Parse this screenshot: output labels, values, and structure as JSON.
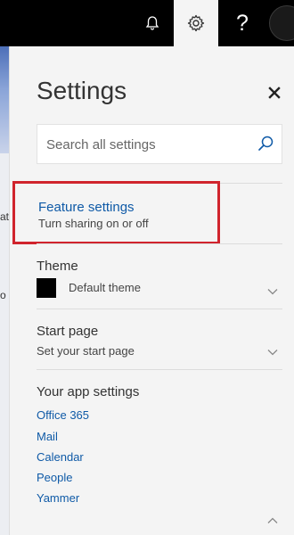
{
  "settings": {
    "title": "Settings",
    "search": {
      "placeholder": "Search all settings"
    },
    "feature": {
      "title": "Feature settings",
      "subtitle": "Turn sharing on or off"
    },
    "theme": {
      "title": "Theme",
      "value": "Default theme",
      "swatch_color": "#000000"
    },
    "start_page": {
      "title": "Start page",
      "subtitle": "Set your start page"
    },
    "app_settings": {
      "title": "Your app settings",
      "links": [
        "Office 365",
        "Mail",
        "Calendar",
        "People",
        "Yammer"
      ]
    }
  },
  "background": {
    "text_fragments": [
      "at",
      "o"
    ]
  },
  "colors": {
    "link": "#0f5aa7",
    "highlight_border": "#d0242d",
    "topbar": "#000000"
  },
  "icons": [
    "bell-icon",
    "gear-icon",
    "help-icon",
    "close-icon",
    "search-icon",
    "chevron-down-icon",
    "chevron-up-icon"
  ]
}
